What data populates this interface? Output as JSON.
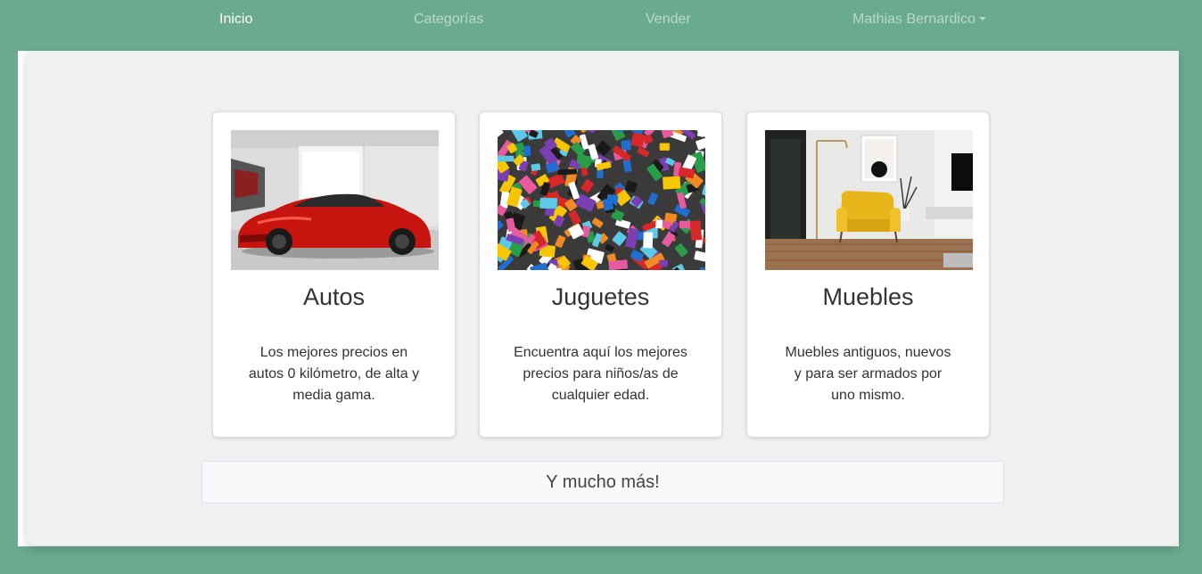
{
  "navbar": {
    "items": [
      {
        "label": "Inicio"
      },
      {
        "label": "Categorías"
      },
      {
        "label": "Vender"
      },
      {
        "label": "Mathias Bernardico"
      }
    ]
  },
  "cards": [
    {
      "title": "Autos",
      "text": "Los mejores precios en autos 0 kilómetro, de alta y media gama.",
      "image": "red-sports-car-photo"
    },
    {
      "title": "Juguetes",
      "text": "Encuentra aquí los mejores precios para niños/as de cualquier edad.",
      "image": "colorful-building-bricks-photo"
    },
    {
      "title": "Muebles",
      "text": "Muebles antiguos, nuevos y para ser armados por uno mismo.",
      "image": "yellow-armchair-living-room-photo"
    }
  ],
  "more": {
    "label": "Y mucho más!"
  },
  "colors": {
    "background": "#6aaa8e",
    "panel": "#eff0f2",
    "card": "#ffffff",
    "nav_active": "#ffffff"
  }
}
